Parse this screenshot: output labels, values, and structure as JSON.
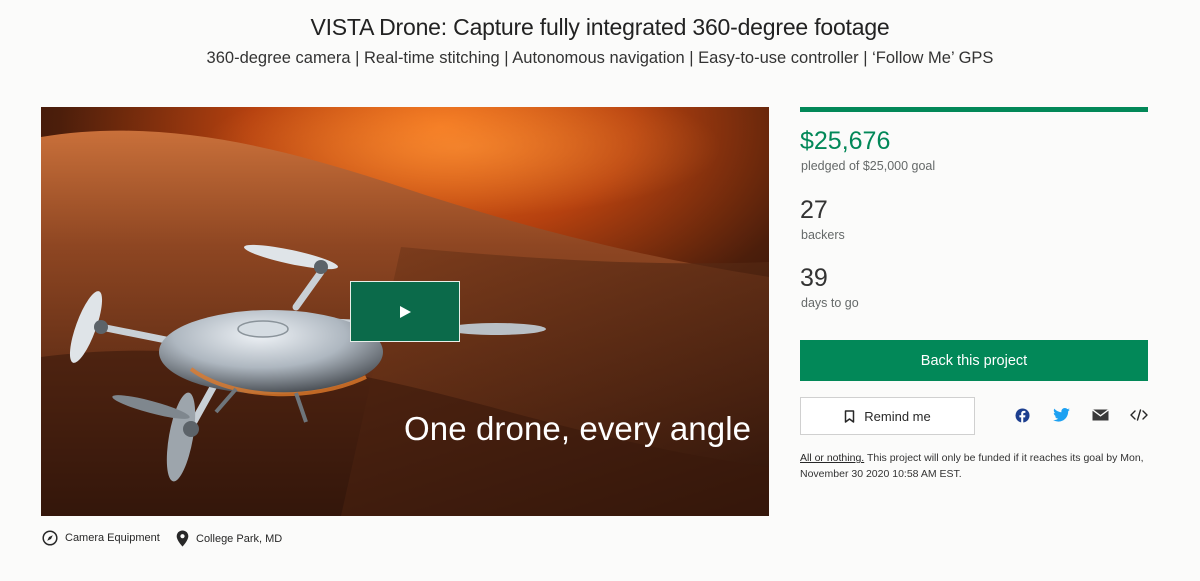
{
  "project": {
    "title": "VISTA Drone: Capture fully integrated 360-degree footage",
    "subtitle": "360-degree camera | Real-time stitching | Autonomous navigation | Easy-to-use controller | ‘Follow Me’ GPS"
  },
  "video": {
    "caption": "One drone, every angle",
    "play_icon": "play-icon"
  },
  "stats": {
    "funded_fraction": 1.0,
    "pledged": "$25,676",
    "pledged_label": "pledged of $25,000 goal",
    "backers": "27",
    "backers_label": "backers",
    "days": "39",
    "days_label": "days to go"
  },
  "actions": {
    "back_label": "Back this project",
    "remind_label": "Remind me",
    "remind_icon": "bookmark-icon",
    "share_icons": [
      "facebook-icon",
      "twitter-icon",
      "email-icon",
      "embed-icon"
    ]
  },
  "fine_print": {
    "link": "All or nothing.",
    "text": " This project will only be funded if it reaches its goal by Mon, November 30 2020 10:58 AM EST."
  },
  "meta": {
    "category": "Camera Equipment",
    "category_icon": "compass-icon",
    "location": "College Park, MD",
    "location_icon": "location-pin-icon"
  },
  "colors": {
    "accent": "#028858",
    "play_button": "#0b6a4a"
  }
}
